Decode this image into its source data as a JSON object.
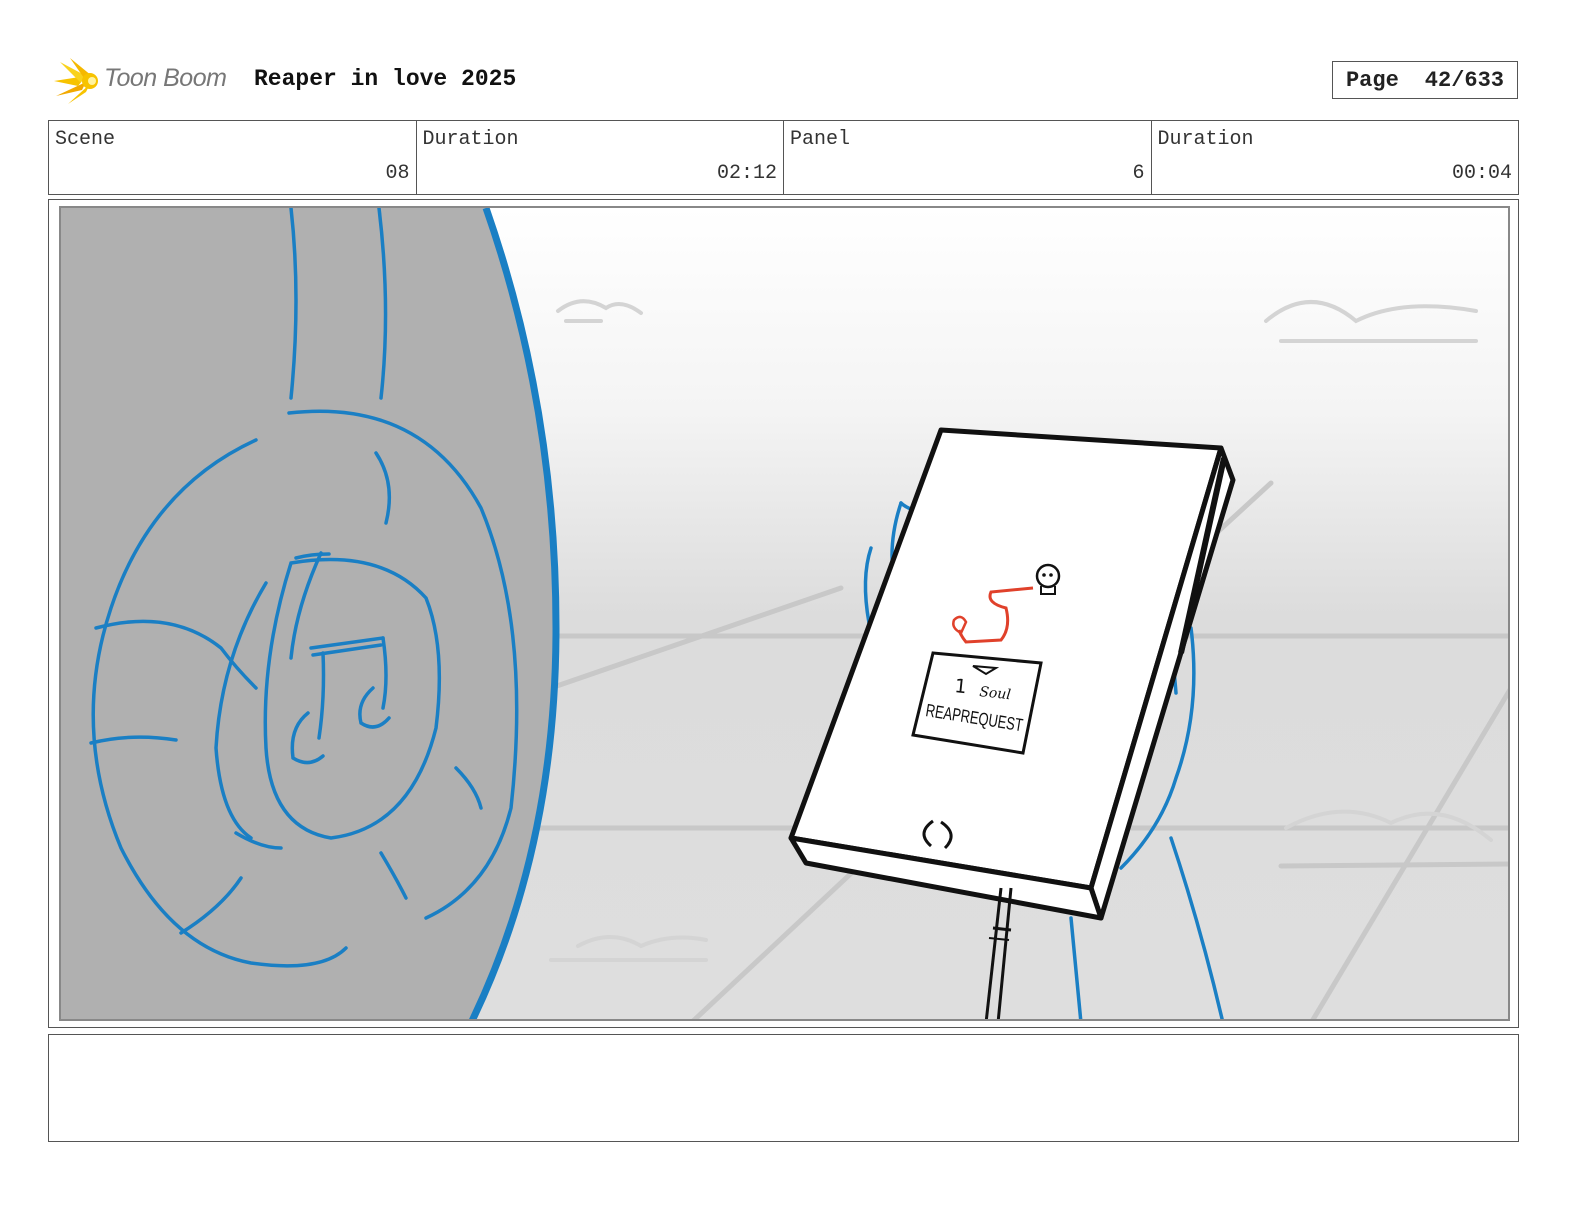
{
  "header": {
    "logo_text": "Toon Boom",
    "title": "Reaper in love 2025",
    "page_label": "Page",
    "page_number": "42/633"
  },
  "info": {
    "scene_label": "Scene",
    "scene_value": "08",
    "scene_duration_label": "Duration",
    "scene_duration_value": "02:12",
    "panel_label": "Panel",
    "panel_value": "6",
    "panel_duration_label": "Duration",
    "panel_duration_value": "00:04"
  },
  "sketch": {
    "phone_count": "1",
    "phone_unit": "Soul",
    "phone_caption": "REAPREQUEST"
  },
  "notes": {
    "text": ""
  },
  "colors": {
    "sketch_blue": "#1a7fc4",
    "route_red": "#e0412b"
  }
}
